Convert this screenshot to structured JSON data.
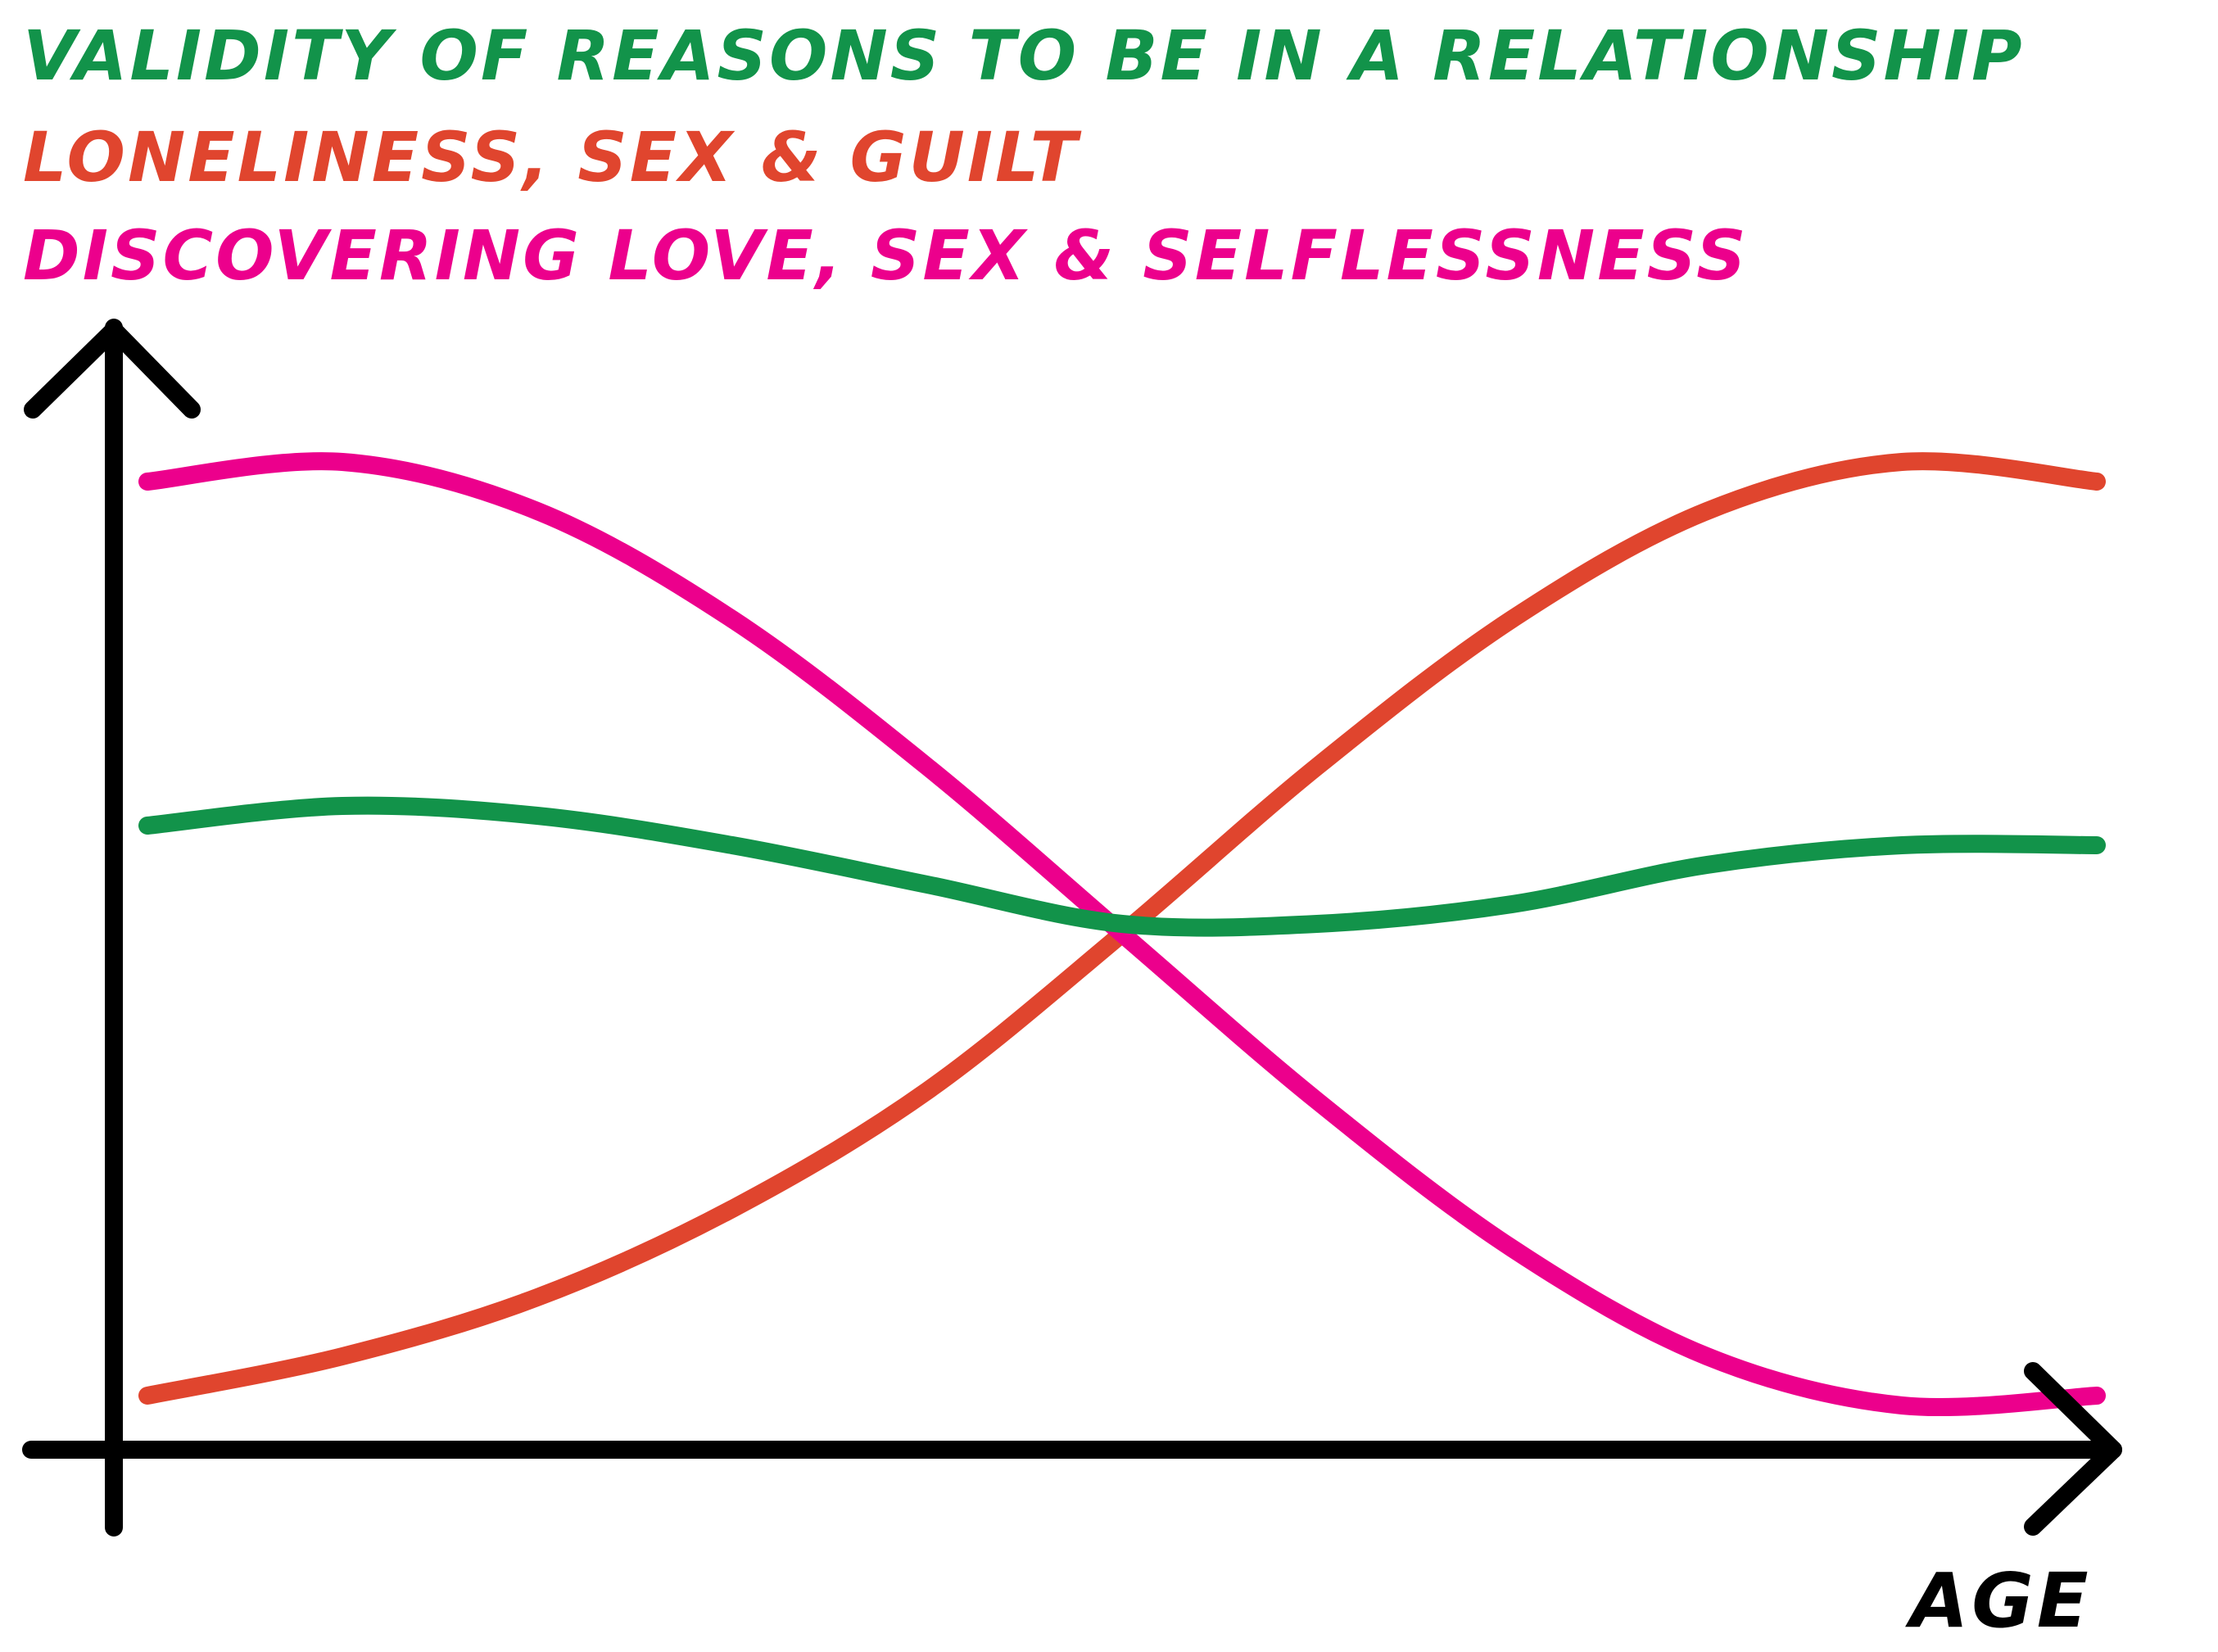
{
  "chart_data": {
    "type": "line",
    "title": "VALIDITY OF REASONS TO BE IN A RELATIONSHIP",
    "xlabel": "AGE",
    "ylabel": "",
    "grid": false,
    "legend": "top-left",
    "x": [
      0,
      10,
      20,
      30,
      40,
      50,
      60,
      70,
      80,
      90,
      100
    ],
    "ylim": [
      0,
      100
    ],
    "series": [
      {
        "name": "LONELINESS, SEX & GUILT",
        "color": "#e0452e",
        "values": [
          3,
          7,
          13,
          22,
          34,
          50,
          67,
          82,
          93,
          98,
          96
        ]
      },
      {
        "name": "DISCOVERING LOVE, SEX & SELFLESSNESS",
        "color": "#ec008c",
        "values": [
          96,
          98,
          93,
          82,
          67,
          50,
          33,
          18,
          7,
          2,
          3
        ]
      },
      {
        "name": "",
        "color": "#12934a",
        "values": [
          61,
          63,
          62,
          59,
          55,
          51,
          51,
          53,
          57,
          59,
          59
        ]
      }
    ],
    "title_color": "#12934a",
    "axis_color": "#000000"
  }
}
